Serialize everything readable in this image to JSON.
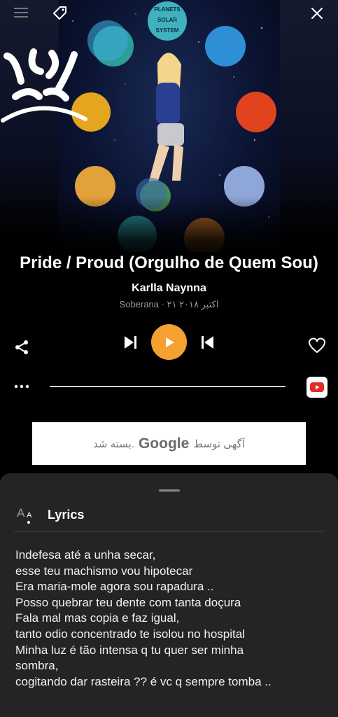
{
  "artwork": {
    "art_text": [
      "PLANETS",
      "SOLAR",
      "SYSTEM"
    ]
  },
  "song": {
    "title": "Pride / Proud (Orgulho de Quem Sou)",
    "artist": "Karlla Naynna",
    "meta": "Soberana · ۲۱ اکتبر ۲۰۱۸"
  },
  "controls": {
    "play_icon": "play-icon",
    "accent_color": "#f5a031"
  },
  "ad": {
    "prefix": "آگهی توسط",
    "brand": "Google",
    "suffix": "بسته شد."
  },
  "lyrics": {
    "title": "Lyrics",
    "lines": [
      "Indefesa até a unha secar,",
      "esse teu machismo vou hipotecar",
      "Era maria-mole agora sou rapadura ..",
      "Posso quebrar teu dente com tanta doçura",
      "Fala mal mas copia e faz igual,",
      "tanto odio concentrado te isolou no hospital",
      "Minha luz é tão intensa q tu quer ser minha",
      "sombra,",
      "cogitando dar rasteira ?? é vc q sempre tomba .."
    ]
  }
}
